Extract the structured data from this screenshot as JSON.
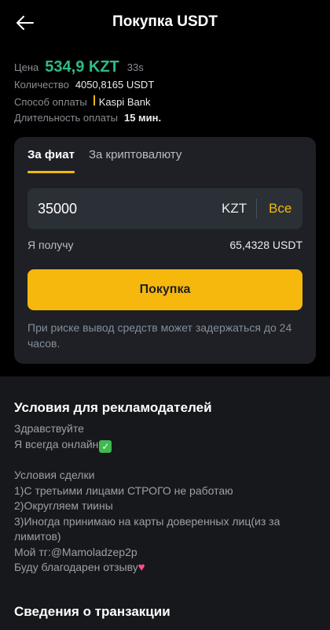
{
  "header": {
    "title": "Покупка USDT",
    "back_icon": "arrow-left-icon"
  },
  "offer": {
    "price_label": "Цена",
    "price_value": "534,9 KZT",
    "timer": "33s",
    "quantity_label": "Количество",
    "quantity_value": "4050,8165 USDT",
    "payment_label": "Способ оплаты",
    "payment_value": "Kaspi Bank",
    "duration_label": "Длительность оплаты",
    "duration_value": "15 мин."
  },
  "order": {
    "tabs": [
      {
        "label": "За фиат",
        "active": true
      },
      {
        "label": "За криптовалюту",
        "active": false
      }
    ],
    "amount_value": "35000",
    "currency": "KZT",
    "all_label": "Все",
    "receive_label": "Я получу",
    "receive_value": "65,4328 USDT",
    "buy_label": "Покупка",
    "risk_note": "При риске вывод средств может задержаться до 24 часов."
  },
  "terms": {
    "title": "Условия для рекламодателей",
    "lines": [
      "Здравствуйте",
      "Я всегда онлайн",
      "",
      "Условия сделки",
      "1)С третьими лицами СТРОГО не работаю",
      "2)Округляем тиины",
      "3)Иногда принимаю на карты доверенных лиц(из за лимитов)",
      "Мой тг:@Mamoladzep2p",
      "Буду благодарен отзыву"
    ],
    "check_emoji": "✓",
    "heart_emoji": "♥"
  },
  "transaction": {
    "title": "Сведения о транзакции"
  },
  "colors": {
    "accent": "#f0b90b",
    "price_green": "#2ebd85",
    "background": "#000000",
    "card": "#1e2026"
  }
}
